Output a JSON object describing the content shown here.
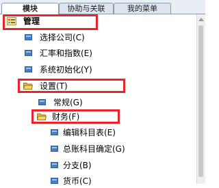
{
  "tabs": [
    {
      "label": "模块",
      "active": true
    },
    {
      "label": "协助与关联",
      "active": false
    },
    {
      "label": "我的菜单",
      "active": false
    }
  ],
  "tree": {
    "root": {
      "label": "管理",
      "icon": "root-folder-icon"
    },
    "items": [
      {
        "label": "选择公司(C)",
        "icon": "document-icon"
      },
      {
        "label": "汇率和指数(E)",
        "icon": "document-icon"
      },
      {
        "label": "系统初始化(Y)",
        "icon": "document-icon"
      },
      {
        "label": "设置(T)",
        "icon": "open-folder-icon"
      },
      {
        "label": "常规(G)",
        "icon": "document-icon"
      },
      {
        "label": "财务(F)",
        "icon": "open-folder-icon"
      },
      {
        "label": "编辑科目表(E)",
        "icon": "document-icon"
      },
      {
        "label": "总账科目确定(G)",
        "icon": "document-icon"
      },
      {
        "label": "分支(B)",
        "icon": "document-icon"
      },
      {
        "label": "货币(C)",
        "icon": "document-icon"
      }
    ]
  },
  "colors": {
    "highlight": "#e8252c",
    "icon_blue": "#4a7fbf",
    "folder": "#f2c94c"
  }
}
